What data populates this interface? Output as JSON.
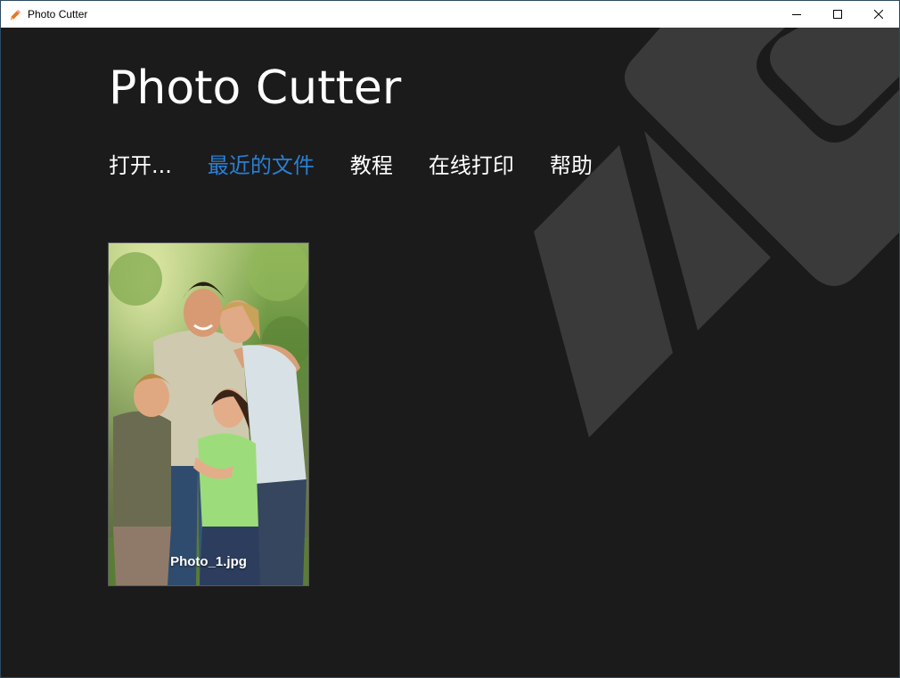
{
  "window": {
    "title": "Photo Cutter",
    "icon": "pencil-icon",
    "controls": [
      "minimize-icon",
      "maximize-icon",
      "close-icon"
    ]
  },
  "app": {
    "title": "Photo Cutter"
  },
  "nav": {
    "open": "打开...",
    "recent": "最近的文件",
    "tutorial": "教程",
    "print": "在线打印",
    "help": "帮助",
    "active": "recent"
  },
  "recent_files": [
    {
      "name": "Photo_1.jpg"
    }
  ],
  "colors": {
    "background": "#1b1b1b",
    "accent": "#2a7fd4",
    "logo_shape": "#3a3a3a",
    "titlebar": "#ffffff"
  }
}
